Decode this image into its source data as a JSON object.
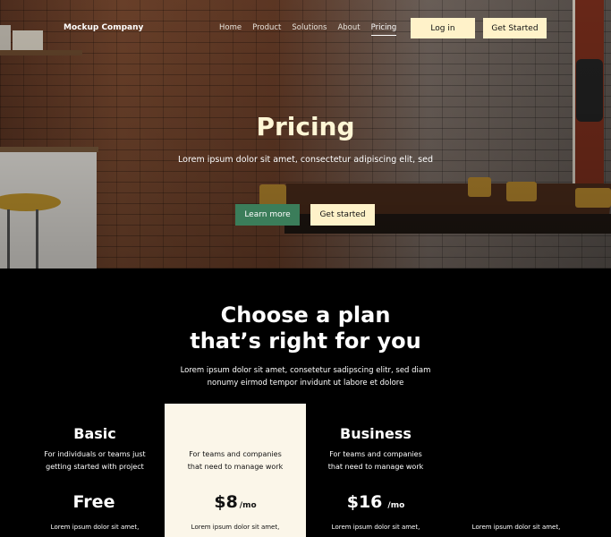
{
  "header": {
    "brand": "Mockup Company",
    "nav": [
      "Home",
      "Product",
      "Solutions",
      "About",
      "Pricing"
    ],
    "active_nav": "Pricing",
    "login_label": "Log in",
    "get_started_label": "Get Started"
  },
  "hero": {
    "title": "Pricing",
    "subtitle": "Lorem ipsum dolor sit amet, consectetur adipiscing elit, sed",
    "learn_more_label": "Learn more",
    "get_started_label": "Get started"
  },
  "plans": {
    "title_line1": "Choose a plan",
    "title_line2": "that’s right for you",
    "subtitle_line1": "Lorem ipsum dolor sit amet, consetetur sadipscing elitr, sed diam",
    "subtitle_line2": "nonumy eirmod tempor invidunt ut labore et dolore",
    "cards": [
      {
        "name": "Basic",
        "desc1": "For individuals or teams just",
        "desc2": "getting started with project",
        "price": "Free",
        "per": "",
        "foot": "Lorem ipsum dolor sit amet,"
      },
      {
        "name": "",
        "desc1": "For teams and companies",
        "desc2": "that need to manage work",
        "price": "$8",
        "per": "/mo",
        "foot": "Lorem ipsum dolor sit amet,"
      },
      {
        "name": "Business",
        "desc1": "For teams and companies",
        "desc2": "that need to manage work",
        "price": "$16",
        "per": "/mo",
        "foot": "Lorem ipsum dolor sit amet,"
      },
      {
        "name": "",
        "desc1": "",
        "desc2": "",
        "price": "",
        "per": "",
        "foot": "Lorem ipsum dolor sit amet,"
      }
    ]
  },
  "colors": {
    "accent_cream": "#fff2c9",
    "accent_green": "#3b7d5a",
    "background_dark": "#000000",
    "featured_card": "#fbf6e9"
  }
}
